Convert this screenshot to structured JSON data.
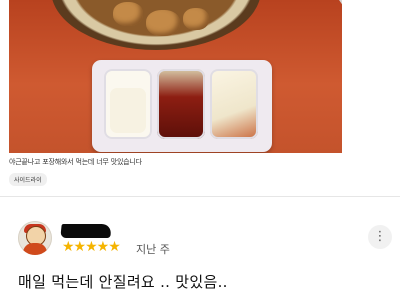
{
  "photo": {
    "caption": "야근끝나고 포장해와서 먹는데 너무 맛있습니다",
    "tag": "사이드라이"
  },
  "review": {
    "rating_stars": "★★★★★",
    "rating_value": 5,
    "time": "지난 주",
    "text": "매일 먹는데 안질려요 .. 맛있음..",
    "more_icon": "more-vert-icon"
  },
  "colors": {
    "star": "#f5b400",
    "tray_bg": "#efeaf0",
    "table": "#c8502c"
  }
}
